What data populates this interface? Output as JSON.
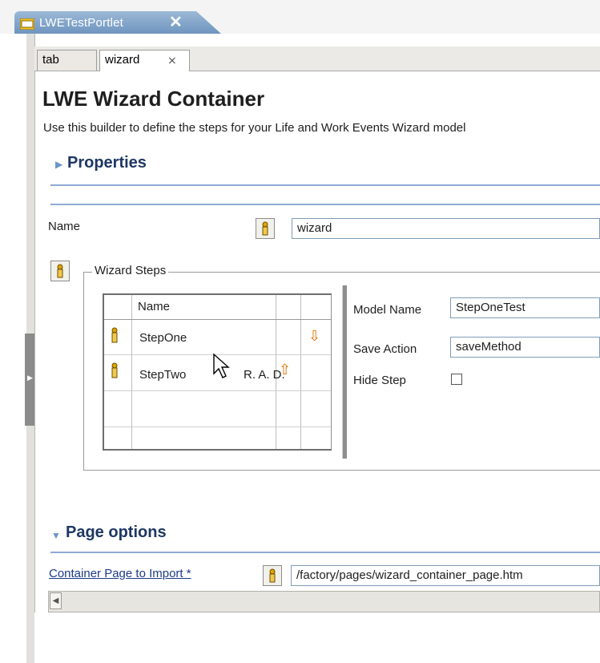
{
  "editor_tab": {
    "title": "LWETestPortlet",
    "close_glyph": "✕",
    "icon": "portlet-icon"
  },
  "subtabs": [
    {
      "label": "tab"
    },
    {
      "label": "wizard",
      "close_glyph": "⨯"
    }
  ],
  "header": {
    "title": "LWE Wizard Container",
    "description": "Use this builder to define the steps for your Life and Work Events Wizard model"
  },
  "properties": {
    "section_title": "Properties",
    "expand_glyph": "▶",
    "name_label": "Name",
    "name_value": "wizard"
  },
  "wizard_steps": {
    "group_label": "Wizard Steps",
    "table": {
      "header_name": "Name",
      "rows": [
        {
          "name": "StepOne",
          "extra": "",
          "arrow": "⇩"
        },
        {
          "name": "StepTwo",
          "extra": "R. A. D.",
          "arrow": "⇧"
        }
      ]
    },
    "model_name_label": "Model Name",
    "model_name_value": "StepOneTest",
    "save_action_label": "Save Action",
    "save_action_value": "saveMethod",
    "hide_step_label": "Hide Step",
    "hide_step_checked": false
  },
  "page_options": {
    "section_title": "Page options",
    "collapse_glyph": "▼",
    "container_page_label": "Container Page to Import *",
    "container_page_value": "/factory/pages/wizard_container_page.htm"
  },
  "scrollbar": {
    "left_glyph": "◀"
  },
  "colors": {
    "accent": "#8eaad3",
    "heading": "#1e3763",
    "link": "#1d3b8a"
  }
}
